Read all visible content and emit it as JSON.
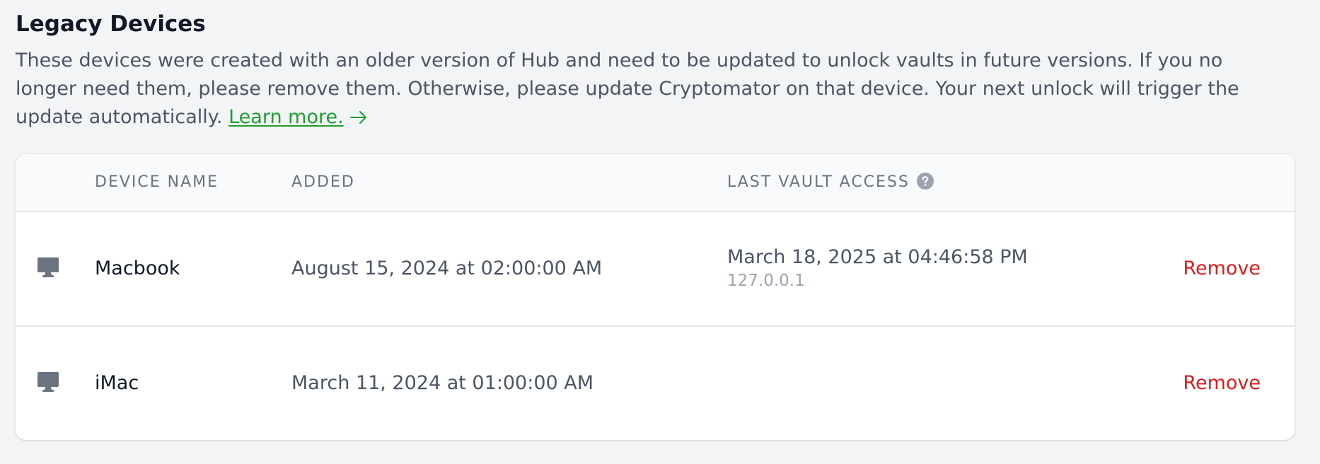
{
  "section": {
    "title": "Legacy Devices",
    "description": "These devices were created with an older version of Hub and need to be updated to unlock vaults in future versions. If you no longer need them, please remove them. Otherwise, please update Cryptomator on that device. Your next unlock will trigger the update automatically.",
    "learn_more_label": "Learn more.",
    "link_color": "#1e9e2f"
  },
  "table": {
    "headers": {
      "device_name": "Device Name",
      "added": "Added",
      "last_vault_access": "Last Vault Access"
    },
    "help_icon": "question-circle-icon",
    "device_icon": "desktop-monitor-icon",
    "remove_color": "#dc1c1c",
    "rows": [
      {
        "name": "Macbook",
        "added": "August 15, 2024 at 02:00:00 AM",
        "last_access": "March 18, 2025 at 04:46:58 PM",
        "ip": "127.0.0.1",
        "remove_label": "Remove"
      },
      {
        "name": "iMac",
        "added": "March 11, 2024 at 01:00:00 AM",
        "last_access": "",
        "ip": "",
        "remove_label": "Remove"
      }
    ]
  }
}
